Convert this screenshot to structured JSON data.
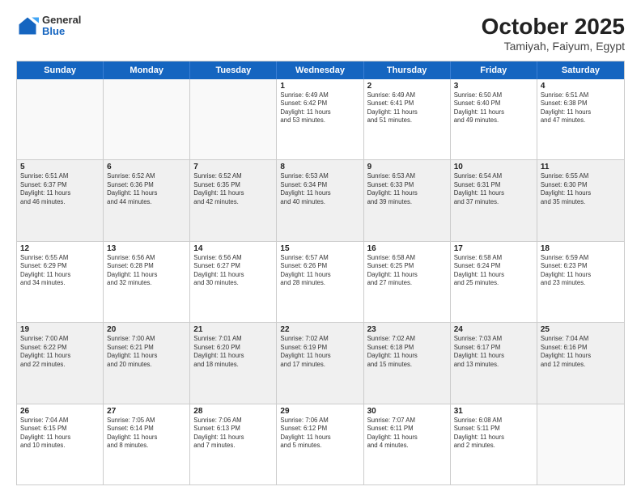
{
  "header": {
    "logo": {
      "general": "General",
      "blue": "Blue"
    },
    "title": "October 2025",
    "location": "Tamiyah, Faiyum, Egypt"
  },
  "weekdays": [
    "Sunday",
    "Monday",
    "Tuesday",
    "Wednesday",
    "Thursday",
    "Friday",
    "Saturday"
  ],
  "rows": [
    [
      {
        "day": "",
        "info": ""
      },
      {
        "day": "",
        "info": ""
      },
      {
        "day": "",
        "info": ""
      },
      {
        "day": "1",
        "info": "Sunrise: 6:49 AM\nSunset: 6:42 PM\nDaylight: 11 hours\nand 53 minutes."
      },
      {
        "day": "2",
        "info": "Sunrise: 6:49 AM\nSunset: 6:41 PM\nDaylight: 11 hours\nand 51 minutes."
      },
      {
        "day": "3",
        "info": "Sunrise: 6:50 AM\nSunset: 6:40 PM\nDaylight: 11 hours\nand 49 minutes."
      },
      {
        "day": "4",
        "info": "Sunrise: 6:51 AM\nSunset: 6:38 PM\nDaylight: 11 hours\nand 47 minutes."
      }
    ],
    [
      {
        "day": "5",
        "info": "Sunrise: 6:51 AM\nSunset: 6:37 PM\nDaylight: 11 hours\nand 46 minutes."
      },
      {
        "day": "6",
        "info": "Sunrise: 6:52 AM\nSunset: 6:36 PM\nDaylight: 11 hours\nand 44 minutes."
      },
      {
        "day": "7",
        "info": "Sunrise: 6:52 AM\nSunset: 6:35 PM\nDaylight: 11 hours\nand 42 minutes."
      },
      {
        "day": "8",
        "info": "Sunrise: 6:53 AM\nSunset: 6:34 PM\nDaylight: 11 hours\nand 40 minutes."
      },
      {
        "day": "9",
        "info": "Sunrise: 6:53 AM\nSunset: 6:33 PM\nDaylight: 11 hours\nand 39 minutes."
      },
      {
        "day": "10",
        "info": "Sunrise: 6:54 AM\nSunset: 6:31 PM\nDaylight: 11 hours\nand 37 minutes."
      },
      {
        "day": "11",
        "info": "Sunrise: 6:55 AM\nSunset: 6:30 PM\nDaylight: 11 hours\nand 35 minutes."
      }
    ],
    [
      {
        "day": "12",
        "info": "Sunrise: 6:55 AM\nSunset: 6:29 PM\nDaylight: 11 hours\nand 34 minutes."
      },
      {
        "day": "13",
        "info": "Sunrise: 6:56 AM\nSunset: 6:28 PM\nDaylight: 11 hours\nand 32 minutes."
      },
      {
        "day": "14",
        "info": "Sunrise: 6:56 AM\nSunset: 6:27 PM\nDaylight: 11 hours\nand 30 minutes."
      },
      {
        "day": "15",
        "info": "Sunrise: 6:57 AM\nSunset: 6:26 PM\nDaylight: 11 hours\nand 28 minutes."
      },
      {
        "day": "16",
        "info": "Sunrise: 6:58 AM\nSunset: 6:25 PM\nDaylight: 11 hours\nand 27 minutes."
      },
      {
        "day": "17",
        "info": "Sunrise: 6:58 AM\nSunset: 6:24 PM\nDaylight: 11 hours\nand 25 minutes."
      },
      {
        "day": "18",
        "info": "Sunrise: 6:59 AM\nSunset: 6:23 PM\nDaylight: 11 hours\nand 23 minutes."
      }
    ],
    [
      {
        "day": "19",
        "info": "Sunrise: 7:00 AM\nSunset: 6:22 PM\nDaylight: 11 hours\nand 22 minutes."
      },
      {
        "day": "20",
        "info": "Sunrise: 7:00 AM\nSunset: 6:21 PM\nDaylight: 11 hours\nand 20 minutes."
      },
      {
        "day": "21",
        "info": "Sunrise: 7:01 AM\nSunset: 6:20 PM\nDaylight: 11 hours\nand 18 minutes."
      },
      {
        "day": "22",
        "info": "Sunrise: 7:02 AM\nSunset: 6:19 PM\nDaylight: 11 hours\nand 17 minutes."
      },
      {
        "day": "23",
        "info": "Sunrise: 7:02 AM\nSunset: 6:18 PM\nDaylight: 11 hours\nand 15 minutes."
      },
      {
        "day": "24",
        "info": "Sunrise: 7:03 AM\nSunset: 6:17 PM\nDaylight: 11 hours\nand 13 minutes."
      },
      {
        "day": "25",
        "info": "Sunrise: 7:04 AM\nSunset: 6:16 PM\nDaylight: 11 hours\nand 12 minutes."
      }
    ],
    [
      {
        "day": "26",
        "info": "Sunrise: 7:04 AM\nSunset: 6:15 PM\nDaylight: 11 hours\nand 10 minutes."
      },
      {
        "day": "27",
        "info": "Sunrise: 7:05 AM\nSunset: 6:14 PM\nDaylight: 11 hours\nand 8 minutes."
      },
      {
        "day": "28",
        "info": "Sunrise: 7:06 AM\nSunset: 6:13 PM\nDaylight: 11 hours\nand 7 minutes."
      },
      {
        "day": "29",
        "info": "Sunrise: 7:06 AM\nSunset: 6:12 PM\nDaylight: 11 hours\nand 5 minutes."
      },
      {
        "day": "30",
        "info": "Sunrise: 7:07 AM\nSunset: 6:11 PM\nDaylight: 11 hours\nand 4 minutes."
      },
      {
        "day": "31",
        "info": "Sunrise: 6:08 AM\nSunset: 5:11 PM\nDaylight: 11 hours\nand 2 minutes."
      },
      {
        "day": "",
        "info": ""
      }
    ]
  ]
}
